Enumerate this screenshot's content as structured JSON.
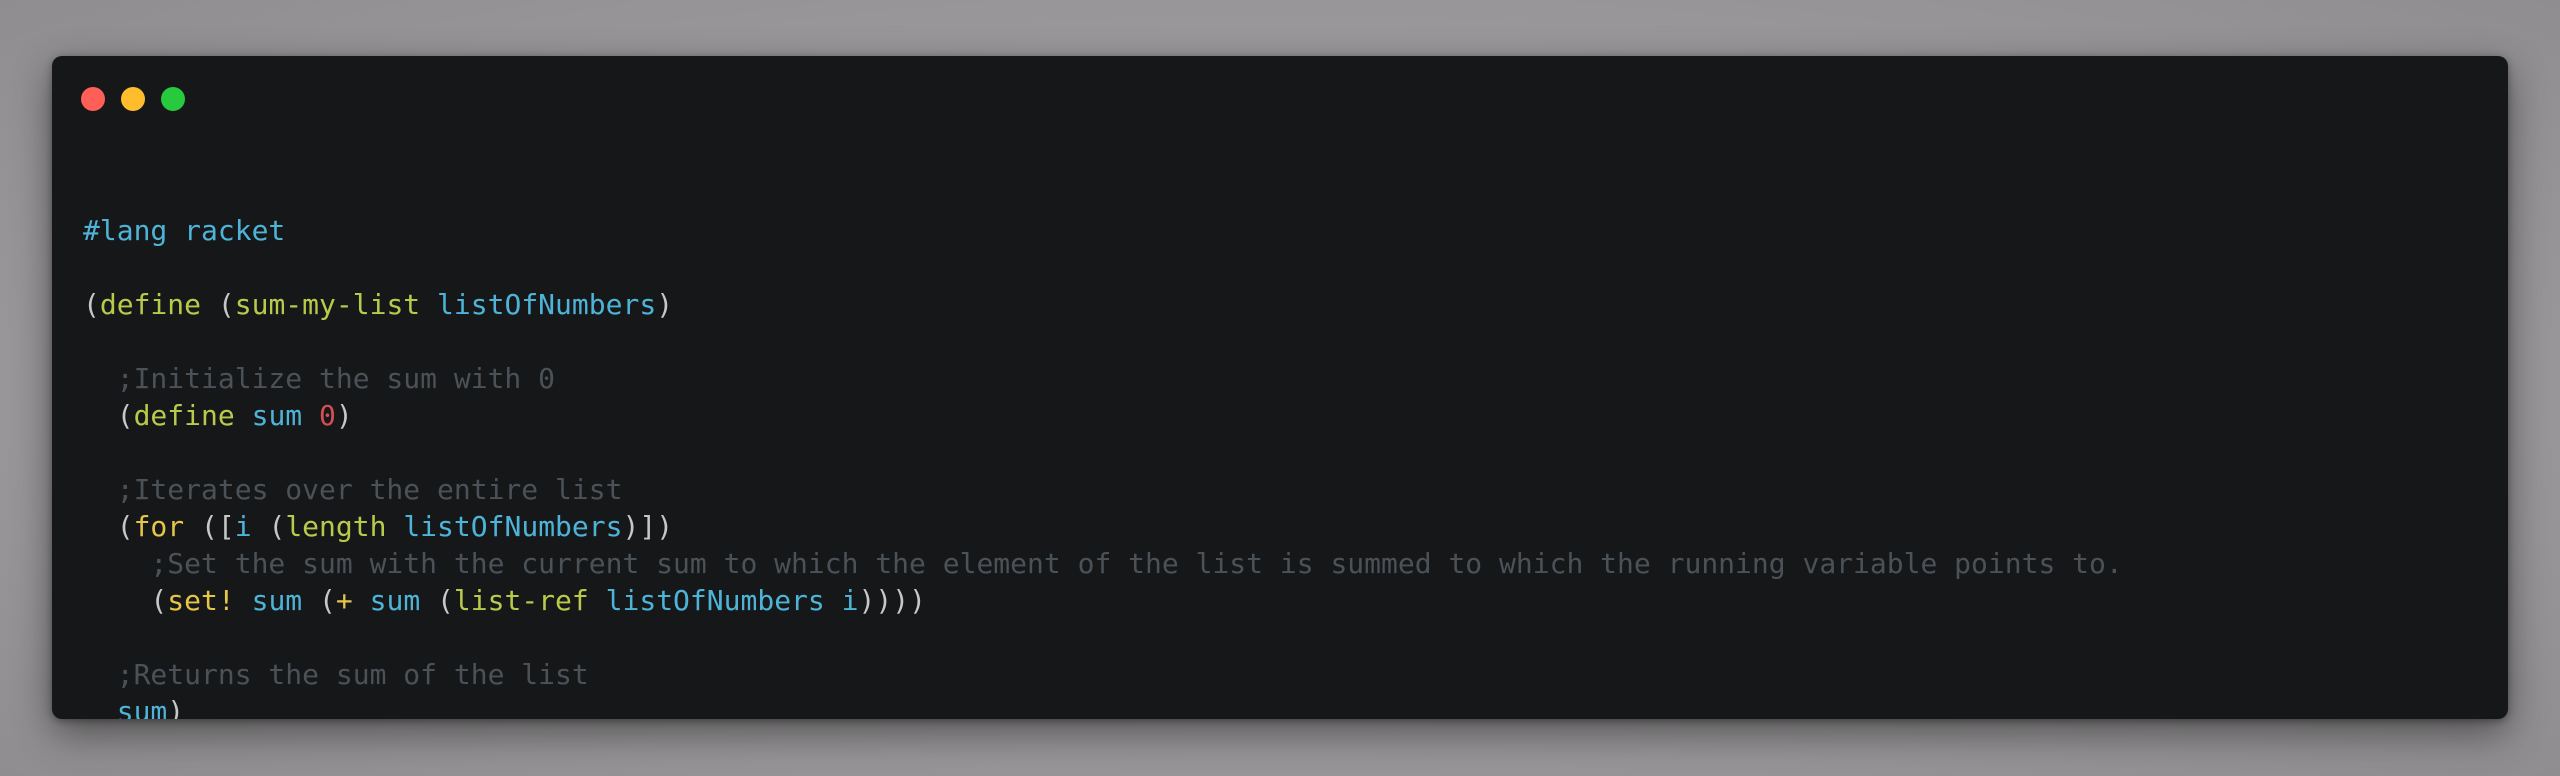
{
  "window": {
    "traffic_lights": {
      "close_color": "#ff5f56",
      "minimize_color": "#ffbd2e",
      "maximize_color": "#27c93f"
    }
  },
  "colors": {
    "background": "#161719",
    "plain": "#c5c8c6",
    "keyword": "#b9ca4a",
    "variable": "#4db4d8",
    "number": "#d54e53",
    "comment": "#4a5258",
    "special": "#e7c547"
  },
  "code": {
    "lines": [
      [
        {
          "t": "lang",
          "s": "#lang racket"
        }
      ],
      [],
      [
        {
          "t": "plain",
          "s": "("
        },
        {
          "t": "keyword",
          "s": "define"
        },
        {
          "t": "plain",
          "s": " ("
        },
        {
          "t": "keyword",
          "s": "sum-my-list"
        },
        {
          "t": "plain",
          "s": " "
        },
        {
          "t": "var",
          "s": "listOfNumbers"
        },
        {
          "t": "plain",
          "s": ")"
        }
      ],
      [],
      [
        {
          "t": "comment",
          "s": "  ;Initialize the sum with 0"
        }
      ],
      [
        {
          "t": "plain",
          "s": "  ("
        },
        {
          "t": "keyword",
          "s": "define"
        },
        {
          "t": "plain",
          "s": " "
        },
        {
          "t": "var",
          "s": "sum"
        },
        {
          "t": "plain",
          "s": " "
        },
        {
          "t": "number",
          "s": "0"
        },
        {
          "t": "plain",
          "s": ")"
        }
      ],
      [],
      [
        {
          "t": "comment",
          "s": "  ;Iterates over the entire list"
        }
      ],
      [
        {
          "t": "plain",
          "s": "  ("
        },
        {
          "t": "special",
          "s": "for"
        },
        {
          "t": "plain",
          "s": " (["
        },
        {
          "t": "var",
          "s": "i"
        },
        {
          "t": "plain",
          "s": " ("
        },
        {
          "t": "keyword",
          "s": "length"
        },
        {
          "t": "plain",
          "s": " "
        },
        {
          "t": "var",
          "s": "listOfNumbers"
        },
        {
          "t": "plain",
          "s": ")])"
        }
      ],
      [
        {
          "t": "comment",
          "s": "    ;Set the sum with the current sum to which the element of the list is summed to which the running variable points to."
        }
      ],
      [
        {
          "t": "plain",
          "s": "    ("
        },
        {
          "t": "special",
          "s": "set!"
        },
        {
          "t": "plain",
          "s": " "
        },
        {
          "t": "var",
          "s": "sum"
        },
        {
          "t": "plain",
          "s": " ("
        },
        {
          "t": "special",
          "s": "+"
        },
        {
          "t": "plain",
          "s": " "
        },
        {
          "t": "var",
          "s": "sum"
        },
        {
          "t": "plain",
          "s": " ("
        },
        {
          "t": "keyword",
          "s": "list-ref"
        },
        {
          "t": "plain",
          "s": " "
        },
        {
          "t": "var",
          "s": "listOfNumbers"
        },
        {
          "t": "plain",
          "s": " "
        },
        {
          "t": "var",
          "s": "i"
        },
        {
          "t": "plain",
          "s": "))))"
        }
      ],
      [],
      [
        {
          "t": "comment",
          "s": "  ;Returns the sum of the list"
        }
      ],
      [
        {
          "t": "plain",
          "s": "  "
        },
        {
          "t": "var",
          "s": "sum"
        },
        {
          "t": "plain",
          "s": ")"
        }
      ]
    ]
  }
}
